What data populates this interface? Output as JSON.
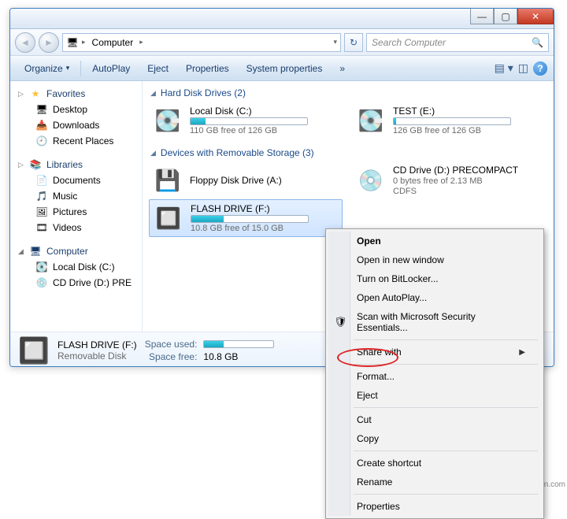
{
  "titlebar": {
    "min": "—",
    "max": "▢",
    "close": "✕"
  },
  "address": {
    "root_icon": "🖥",
    "root": "Computer",
    "search_placeholder": "Search Computer"
  },
  "toolbar": {
    "organize": "Organize",
    "autoplay": "AutoPlay",
    "eject": "Eject",
    "properties": "Properties",
    "sysprops": "System properties",
    "more": "»"
  },
  "nav": {
    "favorites": {
      "label": "Favorites",
      "items": [
        {
          "icon": "🖥",
          "label": "Desktop"
        },
        {
          "icon": "📥",
          "label": "Downloads"
        },
        {
          "icon": "🕘",
          "label": "Recent Places"
        }
      ]
    },
    "libraries": {
      "label": "Libraries",
      "items": [
        {
          "icon": "📄",
          "label": "Documents"
        },
        {
          "icon": "🎵",
          "label": "Music"
        },
        {
          "icon": "🖼",
          "label": "Pictures"
        },
        {
          "icon": "🎞",
          "label": "Videos"
        }
      ]
    },
    "computer": {
      "label": "Computer",
      "items": [
        {
          "icon": "💽",
          "label": "Local Disk (C:)"
        },
        {
          "icon": "💿",
          "label": "CD Drive (D:) PRE"
        }
      ]
    }
  },
  "sections": {
    "hdd": {
      "title": "Hard Disk Drives (2)",
      "drives": [
        {
          "icon": "💽",
          "name": "Local Disk (C:)",
          "free": "110 GB free of 126 GB",
          "pct": 13
        },
        {
          "icon": "💽",
          "name": "TEST (E:)",
          "free": "126 GB free of 126 GB",
          "pct": 2
        }
      ]
    },
    "removable": {
      "title": "Devices with Removable Storage (3)",
      "drives": [
        {
          "icon": "💾",
          "name": "Floppy Disk Drive (A:)",
          "free": "",
          "pct": null
        },
        {
          "icon": "💿",
          "name": "CD Drive (D:) PRECOMPACT",
          "free": "0 bytes free of 2.13 MB",
          "sub": "CDFS",
          "pct": null
        },
        {
          "icon": "🔲",
          "name": "FLASH DRIVE (F:)",
          "free": "10.8 GB free of 15.0 GB",
          "pct": 28,
          "selected": true
        }
      ]
    }
  },
  "details": {
    "name": "FLASH DRIVE (F:)",
    "type": "Removable Disk",
    "used_label": "Space used:",
    "free_label": "Space free:",
    "free_value": "10.8 GB",
    "used_pct": 28
  },
  "context": {
    "open": "Open",
    "open_new": "Open in new window",
    "bitlocker": "Turn on BitLocker...",
    "autoplay": "Open AutoPlay...",
    "scan": "Scan with Microsoft Security Essentials...",
    "share": "Share with",
    "format": "Format...",
    "eject": "Eject",
    "cut": "Cut",
    "copy": "Copy",
    "shortcut": "Create shortcut",
    "rename": "Rename",
    "properties": "Properties"
  },
  "watermark": "wsxdn.com"
}
